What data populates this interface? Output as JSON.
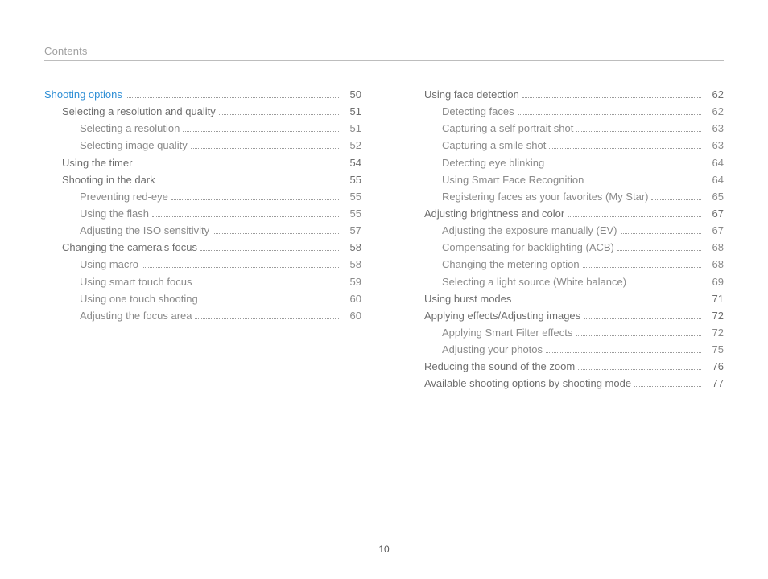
{
  "header": {
    "title": "Contents"
  },
  "footer": {
    "page_number": "10"
  },
  "toc": {
    "left": [
      {
        "level": 0,
        "title": "Shooting options",
        "page": "50",
        "section": true
      },
      {
        "level": 1,
        "title": "Selecting a resolution and quality",
        "page": "51"
      },
      {
        "level": 2,
        "title": "Selecting a resolution",
        "page": "51"
      },
      {
        "level": 2,
        "title": "Selecting image quality",
        "page": "52"
      },
      {
        "level": 1,
        "title": "Using the timer",
        "page": "54"
      },
      {
        "level": 1,
        "title": "Shooting in the dark",
        "page": "55"
      },
      {
        "level": 2,
        "title": "Preventing red-eye",
        "page": "55"
      },
      {
        "level": 2,
        "title": "Using the flash",
        "page": "55"
      },
      {
        "level": 2,
        "title": "Adjusting the ISO sensitivity",
        "page": "57"
      },
      {
        "level": 1,
        "title": "Changing the camera's focus",
        "page": "58"
      },
      {
        "level": 2,
        "title": "Using macro",
        "page": "58"
      },
      {
        "level": 2,
        "title": "Using smart touch focus",
        "page": "59"
      },
      {
        "level": 2,
        "title": "Using one touch shooting",
        "page": "60"
      },
      {
        "level": 2,
        "title": "Adjusting the focus area",
        "page": "60"
      }
    ],
    "right": [
      {
        "level": 1,
        "title": "Using face detection",
        "page": "62"
      },
      {
        "level": 2,
        "title": "Detecting faces",
        "page": "62"
      },
      {
        "level": 2,
        "title": "Capturing a self portrait shot",
        "page": "63"
      },
      {
        "level": 2,
        "title": "Capturing a smile shot",
        "page": "63"
      },
      {
        "level": 2,
        "title": "Detecting eye blinking",
        "page": "64"
      },
      {
        "level": 2,
        "title": "Using Smart Face Recognition",
        "page": "64"
      },
      {
        "level": 2,
        "title": "Registering faces as your favorites (My Star)",
        "page": "65"
      },
      {
        "level": 1,
        "title": "Adjusting brightness and color",
        "page": "67"
      },
      {
        "level": 2,
        "title": "Adjusting the exposure manually (EV)",
        "page": "67"
      },
      {
        "level": 2,
        "title": "Compensating for backlighting (ACB)",
        "page": "68"
      },
      {
        "level": 2,
        "title": "Changing the metering option",
        "page": "68"
      },
      {
        "level": 2,
        "title": "Selecting a light source (White balance)",
        "page": "69"
      },
      {
        "level": 1,
        "title": "Using burst modes",
        "page": "71"
      },
      {
        "level": 1,
        "title": "Applying effects/Adjusting images",
        "page": "72"
      },
      {
        "level": 2,
        "title": "Applying Smart Filter effects",
        "page": "72"
      },
      {
        "level": 2,
        "title": "Adjusting your photos",
        "page": "75"
      },
      {
        "level": 1,
        "title": "Reducing the sound of the zoom",
        "page": "76"
      },
      {
        "level": 1,
        "title": "Available shooting options by shooting mode",
        "page": "77"
      }
    ]
  }
}
